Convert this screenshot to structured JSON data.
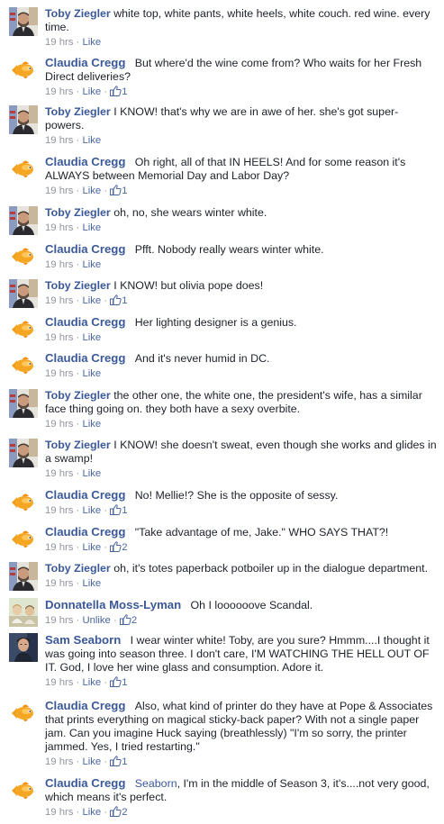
{
  "comments": [
    {
      "author": "Toby Ziegler",
      "avatar": "toby",
      "text": "white top, white pants, white heels, white couch. red wine. every time.",
      "time": "19 hrs",
      "action": "Like",
      "likes": ""
    },
    {
      "author": "Claudia Cregg",
      "avatar": "goldfish",
      "text": "But where'd the wine come from? Who waits for her Fresh Direct deliveries?",
      "time": "19 hrs",
      "action": "Like",
      "likes": "1"
    },
    {
      "author": "Toby Ziegler",
      "avatar": "toby",
      "text": "I KNOW! that's why we are in awe of her. she's got super-powers.",
      "time": "19 hrs",
      "action": "Like",
      "likes": ""
    },
    {
      "author": "Claudia Cregg",
      "avatar": "goldfish",
      "text": "Oh right, all of that IN HEELS! And for some reason it's ALWAYS between Memorial Day and Labor Day?",
      "time": "19 hrs",
      "action": "Like",
      "likes": "1"
    },
    {
      "author": "Toby Ziegler",
      "avatar": "toby",
      "text": "oh, no, she wears winter white.",
      "time": "19 hrs",
      "action": "Like",
      "likes": ""
    },
    {
      "author": "Claudia Cregg",
      "avatar": "goldfish",
      "text": "Pfft. Nobody really wears winter white.",
      "time": "19 hrs",
      "action": "Like",
      "likes": ""
    },
    {
      "author": "Toby Ziegler",
      "avatar": "toby",
      "text": "I KNOW! but olivia pope does!",
      "time": "19 hrs",
      "action": "Like",
      "likes": "1"
    },
    {
      "author": "Claudia Cregg",
      "avatar": "goldfish",
      "text": "Her lighting designer is a genius.",
      "time": "19 hrs",
      "action": "Like",
      "likes": ""
    },
    {
      "author": "Claudia Cregg",
      "avatar": "goldfish",
      "text": "And it's never humid in DC.",
      "time": "19 hrs",
      "action": "Like",
      "likes": ""
    },
    {
      "author": "Toby Ziegler",
      "avatar": "toby",
      "text": "the other one, the white one, the president's wife, has a similar face thing going on. they both have a sexy overbite.",
      "time": "19 hrs",
      "action": "Like",
      "likes": ""
    },
    {
      "author": "Toby Ziegler",
      "avatar": "toby",
      "text": "I KNOW! she doesn't sweat, even though she works and glides in a swamp!",
      "time": "19 hrs",
      "action": "Like",
      "likes": ""
    },
    {
      "author": "Claudia Cregg",
      "avatar": "goldfish",
      "text": "No! Mellie!? She is the opposite of sessy.",
      "time": "19 hrs",
      "action": "Like",
      "likes": "1"
    },
    {
      "author": "Claudia Cregg",
      "avatar": "goldfish",
      "text": "\"Take advantage of me, Jake.\" WHO SAYS THAT?!",
      "time": "19 hrs",
      "action": "Like",
      "likes": "2"
    },
    {
      "author": "Toby Ziegler",
      "avatar": "toby",
      "text": "oh, it's totes paperback potboiler up in the dialogue department.",
      "time": "19 hrs",
      "action": "Like",
      "likes": ""
    },
    {
      "author": "Donnatella Moss-Lyman",
      "avatar": "donna",
      "text": "Oh I loooooove Scandal.",
      "time": "19 hrs",
      "action": "Unlike",
      "likes": "2"
    },
    {
      "author": "Sam Seaborn",
      "avatar": "sam",
      "text": "I wear winter white!   Toby, are you sure? Hmmm....I thought it was going into season three. I don't care, I'M WATCHING THE HELL OUT OF IT. God, I love her wine glass and consumption. Adore it.",
      "time": "19 hrs",
      "action": "Like",
      "likes": "1"
    },
    {
      "author": "Claudia Cregg",
      "avatar": "goldfish",
      "text": "Also, what kind of printer do they have at Pope & Associates that prints everything on magical sticky-back paper? With not a single paper jam. Can you imagine Huck saying (breathlessly) \"I'm so sorry, the printer jammed. Yes, I tried restarting.\"",
      "time": "19 hrs",
      "action": "Like",
      "likes": "1"
    },
    {
      "author": "Claudia Cregg",
      "avatar": "goldfish",
      "mention": "Seaborn",
      "text": ", I'm in the middle of Season 3, it's....not very good, which means it's perfect.",
      "time": "19 hrs",
      "action": "Like",
      "likes": "2"
    }
  ]
}
